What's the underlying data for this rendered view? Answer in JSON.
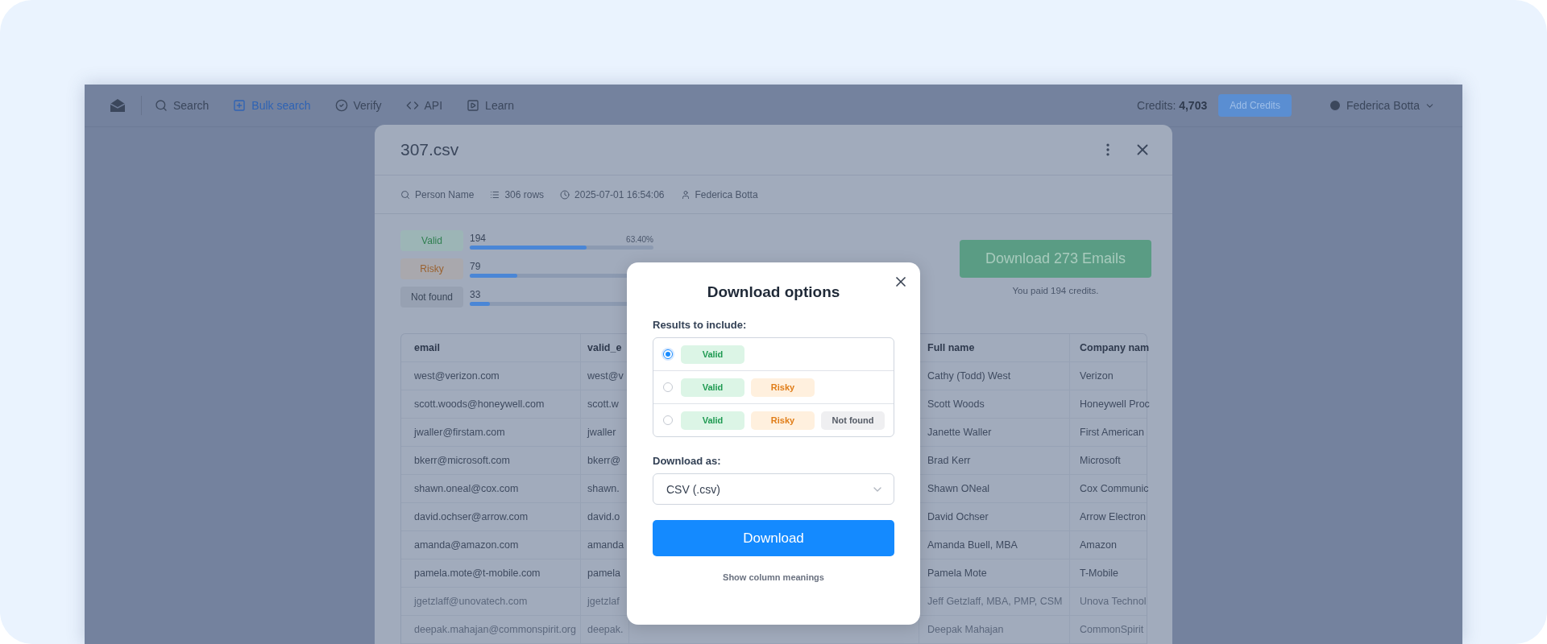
{
  "nav": {
    "items": [
      {
        "label": "Search",
        "selected": false
      },
      {
        "label": "Bulk search",
        "selected": true
      },
      {
        "label": "Verify",
        "selected": false
      },
      {
        "label": "API",
        "selected": false
      },
      {
        "label": "Learn",
        "selected": false
      }
    ],
    "credits": "Credits: **4,703**",
    "add_credits": "Add Credits",
    "user": "Federica Botta"
  },
  "file_dialog": {
    "title": "307.csv",
    "meta": [
      "Person Name",
      "306 rows",
      "2025-07-01 16:54:06",
      "Federica Botta"
    ],
    "stats": [
      {
        "kind": "valid",
        "label": "Valid",
        "count": "194",
        "percent": "63.40%",
        "level": 0.634
      },
      {
        "kind": "risky",
        "label": "Risky",
        "count": "79",
        "level": 0.258
      },
      {
        "kind": "missing",
        "label": "Not found",
        "count": "33",
        "level": 0.108
      }
    ],
    "download_button": "Download 273 Emails",
    "paid_note": "You paid 194 credits.",
    "table": {
      "columns": [
        "email",
        "valid_e",
        "Full name",
        "Company nam"
      ],
      "rows": [
        {
          "cells": [
            "west@verizon.com",
            "west@v",
            "Cathy (Todd) West",
            "Verizon"
          ],
          "faded": false
        },
        {
          "cells": [
            "scott.woods@honeywell.com",
            "scott.w",
            "Scott Woods",
            "Honeywell Proc"
          ],
          "faded": false
        },
        {
          "cells": [
            "jwaller@firstam.com",
            "jwaller",
            "Janette Waller",
            "First American"
          ],
          "faded": false
        },
        {
          "cells": [
            "bkerr@microsoft.com",
            "bkerr@",
            "Brad Kerr",
            "Microsoft"
          ],
          "faded": false
        },
        {
          "cells": [
            "shawn.oneal@cox.com",
            "shawn.",
            "Shawn ONeal",
            "Cox Communic"
          ],
          "faded": false
        },
        {
          "cells": [
            "david.ochser@arrow.com",
            "david.o",
            "David Ochser",
            "Arrow Electron"
          ],
          "faded": false
        },
        {
          "cells": [
            "amanda@amazon.com",
            "amanda",
            "Amanda Buell, MBA",
            "Amazon"
          ],
          "faded": false
        },
        {
          "cells": [
            "pamela.mote@t-mobile.com",
            "pamela",
            "Pamela Mote",
            "T-Mobile"
          ],
          "faded": false
        },
        {
          "cells": [
            "jgetzlaff@unovatech.com",
            "jgetzlaf",
            "Jeff Getzlaff, MBA, PMP, CSM",
            "Unova Technol"
          ],
          "faded": true
        },
        {
          "cells": [
            "deepak.mahajan@commonspirit.org",
            "deepak.",
            "Deepak Mahajan",
            "CommonSpirit"
          ],
          "faded": true
        }
      ]
    }
  },
  "download_modal": {
    "title": "Download options",
    "results_label": "Results to include:",
    "options": [
      {
        "selected": true,
        "badges": [
          {
            "kind": "valid",
            "label": "Valid"
          }
        ]
      },
      {
        "selected": false,
        "badges": [
          {
            "kind": "valid",
            "label": "Valid"
          },
          {
            "kind": "risky",
            "label": "Risky"
          }
        ]
      },
      {
        "selected": false,
        "badges": [
          {
            "kind": "valid",
            "label": "Valid"
          },
          {
            "kind": "risky",
            "label": "Risky"
          },
          {
            "kind": "missing",
            "label": "Not found"
          }
        ]
      }
    ],
    "format_label": "Download as:",
    "format_value": "CSV (.csv)",
    "button": "Download",
    "link": "Show column meanings"
  }
}
